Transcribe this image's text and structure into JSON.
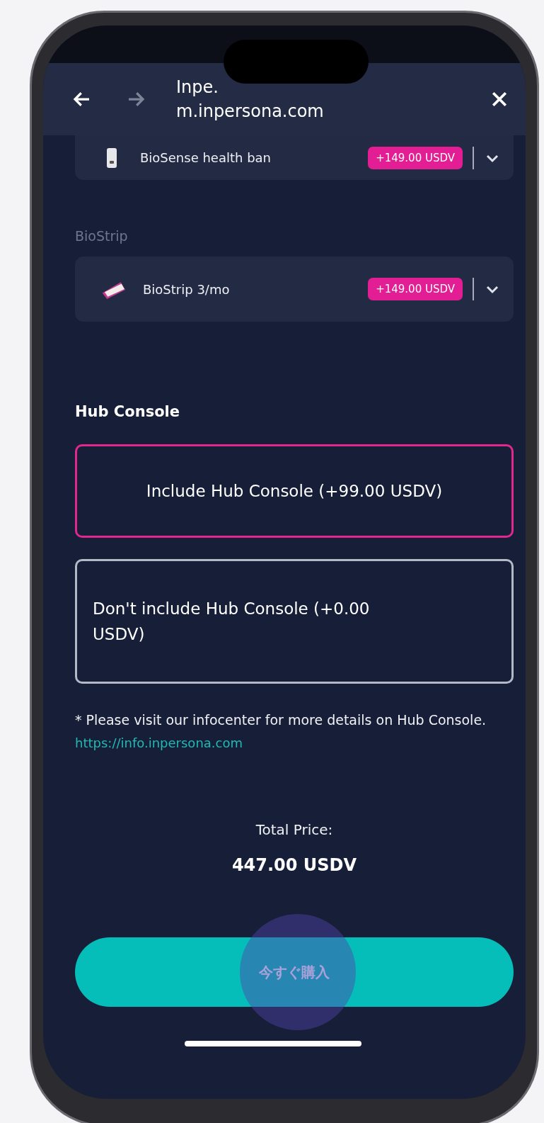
{
  "browser_bar": {
    "title": "Inpe.",
    "url": "m.inpersona.com"
  },
  "products": [
    {
      "kind": "band",
      "name": "BioSense health ban",
      "price": "+149.00 USDV"
    },
    {
      "label": "BioStrip",
      "kind": "strip",
      "name": "BioStrip 3/mo",
      "price": "+149.00 USDV"
    }
  ],
  "hub_console": {
    "heading": "Hub Console",
    "options": [
      {
        "text": "Include Hub Console (+99.00 USDV)",
        "selected": true
      },
      {
        "text": "Don't include Hub Console (+0.00 USDV)",
        "selected": false
      }
    ]
  },
  "note": "* Please visit our infocenter for more details on Hub Console.",
  "link": "https://info.inpersona.com",
  "total": {
    "label": "Total Price:",
    "amount": "447.00 USDV"
  },
  "buy_button": "今すぐ購入"
}
